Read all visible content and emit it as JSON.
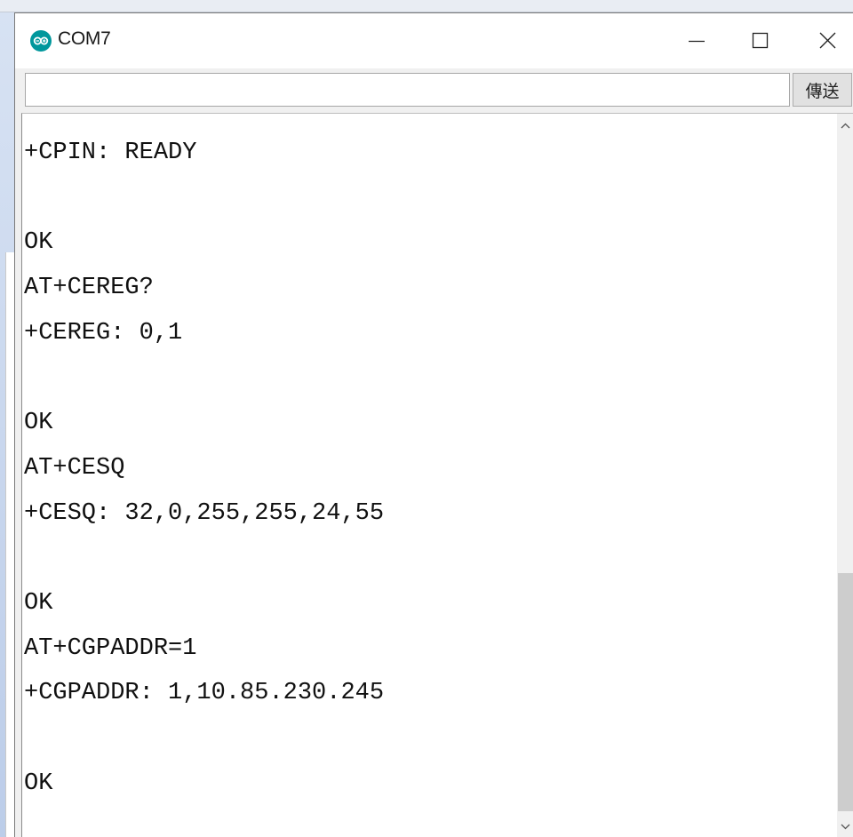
{
  "window": {
    "title": "COM7",
    "icon": "arduino-icon",
    "controls": [
      "minimize-icon",
      "maximize-icon",
      "close-icon"
    ]
  },
  "send": {
    "input_value": "",
    "button_label": "傳送"
  },
  "output": {
    "lines": [
      "+CPIN: READY",
      "",
      "OK",
      "AT+CEREG?",
      "+CEREG: 0,1",
      "",
      "OK",
      "AT+CESQ",
      "+CESQ: 32,0,255,255,24,55",
      "",
      "OK",
      "AT+CGPADDR=1",
      "+CGPADDR: 1,10.85.230.245",
      "",
      "OK"
    ]
  },
  "colors": {
    "accent": "#00979c"
  }
}
